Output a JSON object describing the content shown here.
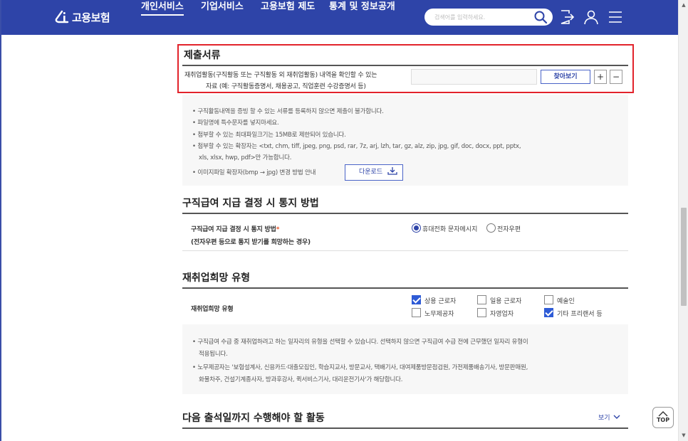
{
  "header": {
    "logo_text": "고용보험",
    "nav": [
      {
        "label": "개인서비스",
        "active": true
      },
      {
        "label": "기업서비스",
        "active": false
      },
      {
        "label": "고용보험 제도",
        "active": false
      },
      {
        "label": "통계 및 정보공개",
        "active": false
      }
    ],
    "search_placeholder": "검색어를 입력하세요."
  },
  "documents": {
    "title": "제출서류",
    "desc_line1": "재취업활동(구직활동 또는 구직활동 외 재취업활동) 내역을 확인할 수 있는",
    "desc_line2": "자료 (예: 구직활동증명서, 채용공고, 직업훈련 수강증명서 등)",
    "find_button": "찾아보기",
    "add_button": "+",
    "remove_button": "−",
    "bullets": [
      "구직활동내역을 증빙 할 수 있는 서류를 등록하지 않으면 제출이 불가합니다.",
      "파일명에 특수문자를 넣지마세요.",
      "첨부할 수 있는 최대파일크기는 15MB로 제한되어 있습니다.",
      "첨부할 수 있는 확장자는 <txt, chm, tiff, jpeg, png, psd, rar, 7z, arj, lzh, tar, gz, alz, zip, jpg, gif, doc, docx, ppt, pptx,",
      "xls, xlsx, hwp, pdf>만 가능합니다.",
      "이미지파일 확장자(bmp → jpg) 변경 방법 안내"
    ],
    "download_button": "다운로드"
  },
  "notification": {
    "title": "구직급여 지급 결정 시 통지 방법",
    "label_line1": "구직급여 지급 결정 시 통지 방법",
    "label_line2": "(전자우편 등으로 통지 받기를 희망하는 경우)",
    "required_mark": "*",
    "options": [
      {
        "label": "휴대전화 문자메시지",
        "checked": true
      },
      {
        "label": "전자우편",
        "checked": false
      }
    ]
  },
  "reemployment": {
    "title": "재취업희망 유형",
    "label": "재취업희망 유형",
    "options": [
      {
        "label": "상용 근로자",
        "checked": true
      },
      {
        "label": "일용 근로자",
        "checked": false
      },
      {
        "label": "예술인",
        "checked": false
      },
      {
        "label": "노무제공자",
        "checked": false
      },
      {
        "label": "자영업자",
        "checked": false
      },
      {
        "label": "기타 프리랜서 등",
        "checked": true
      }
    ],
    "notes": [
      "구직급여 수급 중 재취업하려고 하는 일자리의 유형을 선택할 수 있습니다. 선택하지 않으면 구직급여 수급 전에 근무했던 일자리 유형이",
      "적용됩니다.",
      "노무제공자는 '보험설계사, 신용카드·대출모집인, 학습지교사, 방문교사, 택배기사, 대여제품방문점검원, 가전제품배송기사, 방문판매원,",
      "화물차주, 건설기계종사자, 방과후강사, 퀵서비스기사, 대리운전기사'가 해당합니다."
    ]
  },
  "next_activity": {
    "title": "다음 출석일까지 수행해야 할 활동",
    "more_link": "보기"
  },
  "top_button": "TOP",
  "colors": {
    "brand": "#2e44a8",
    "highlight": "#e2232b",
    "checkbox": "#2e5bd6"
  }
}
